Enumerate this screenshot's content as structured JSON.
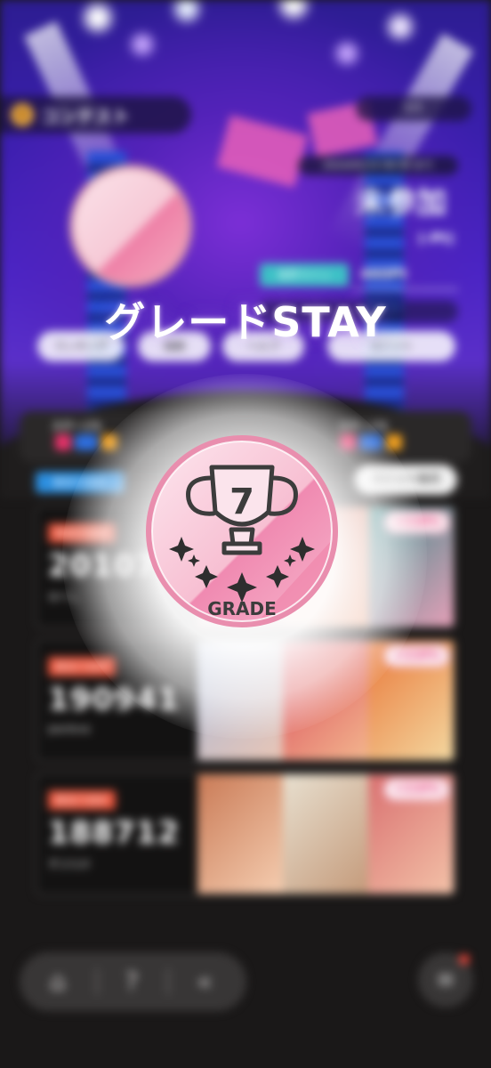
{
  "header": {
    "contest_label": "コンテスト",
    "page_counter": "1/1",
    "deadline": "2024/05/14 08:59 まで",
    "status": "未参加",
    "points": "(-Pt)",
    "border_label": "境界ライン",
    "border_value": "460Pt",
    "buttons": [
      "ランキング",
      "報酬",
      "ヘルプ",
      "ユニット"
    ]
  },
  "stage": {
    "left_label": "ステージ1",
    "right_label": "ステージ1",
    "left_swatches": [
      "#e8336b",
      "#2e6fe0",
      "#f0a020"
    ],
    "right_swatches": [
      "#e8336b",
      "#2e6fe0",
      "#f0a020"
    ]
  },
  "list": {
    "total_power_chip": "総合力合計",
    "unit_edit_label": "ユニット編成",
    "rows": [
      {
        "chip": "総合力合計",
        "score": "201078",
        "name": "ゆべし",
        "bonus": "+110%"
      },
      {
        "chip": "総合力合計",
        "score": "190941",
        "name": "pavlova",
        "bonus": "+110%"
      },
      {
        "chip": "総合力合計",
        "score": "188712",
        "name": "ずぶらか",
        "bonus": "+110%"
      }
    ]
  },
  "overlay": {
    "headline": "グレードSTAY",
    "grade_number": "7",
    "grade_word": "GRADE"
  },
  "nav": {
    "icons": [
      "home-icon",
      "help-icon",
      "back-icon",
      "menu-icon"
    ],
    "notification": true
  },
  "colors": {
    "accent_pink": "#ee7fa6",
    "bonus_pink": "#e94f86",
    "chip_red": "#e8533a",
    "chip_blue": "#2c8fe0",
    "teal": "#3dc0c6"
  }
}
